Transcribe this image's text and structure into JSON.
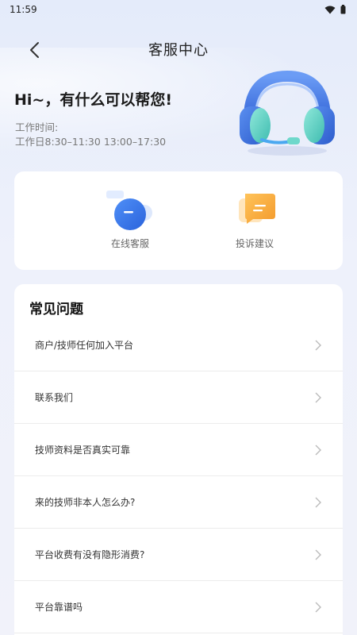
{
  "status_bar": {
    "time": "11:59",
    "icons": [
      "wifi-icon",
      "battery-icon"
    ]
  },
  "header": {
    "title": "客服中心",
    "back_icon": "chevron-left-icon"
  },
  "hero": {
    "greeting": "Hi~，有什么可以帮您!",
    "work_time_label": "工作时间:",
    "work_time_value": "工作日8:30–11:30 13:00–17:30",
    "illustration": "headset-icon"
  },
  "services": [
    {
      "label": "在线客服",
      "icon": "chat-bubble-icon"
    },
    {
      "label": "投诉建议",
      "icon": "message-icon"
    }
  ],
  "faq": {
    "title": "常见问题",
    "items": [
      {
        "question": "商户/技师任何加入平台"
      },
      {
        "question": "联系我们"
      },
      {
        "question": "技师资料是否真实可靠"
      },
      {
        "question": "来的技师非本人怎么办?"
      },
      {
        "question": "平台收费有没有隐形消费?"
      },
      {
        "question": "平台靠谱吗"
      }
    ]
  },
  "colors": {
    "accent_blue": "#3c7ff0",
    "accent_orange": "#f7a53a",
    "headset_teal": "#5ed3c6"
  }
}
